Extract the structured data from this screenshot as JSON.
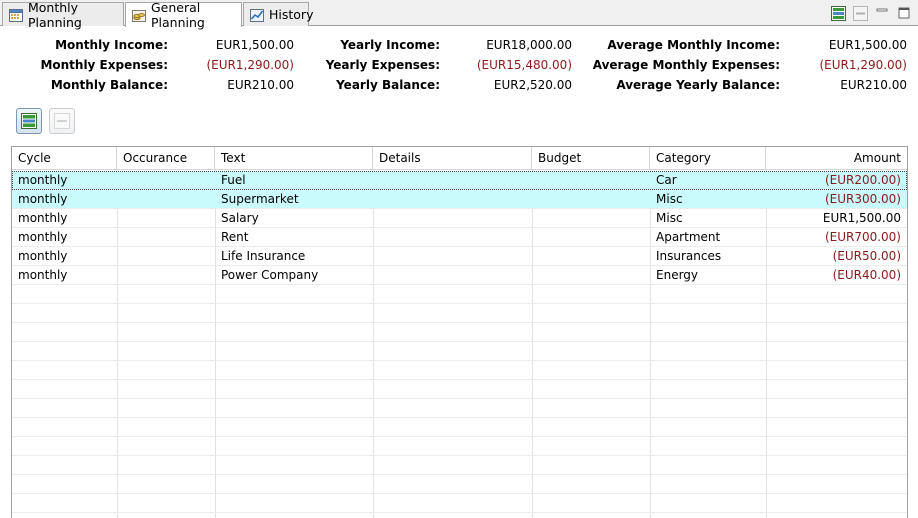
{
  "tabs": [
    {
      "label": "Monthly Planning",
      "icon": "calendar-icon"
    },
    {
      "label": "General Planning",
      "icon": "coins-icon"
    },
    {
      "label": "History",
      "icon": "chart-icon"
    }
  ],
  "summary": {
    "monthly_income_label": "Monthly Income:",
    "monthly_income_value": "EUR1,500.00",
    "monthly_expenses_label": "Monthly Expenses:",
    "monthly_expenses_value": "(EUR1,290.00)",
    "monthly_balance_label": "Monthly Balance:",
    "monthly_balance_value": "EUR210.00",
    "yearly_income_label": "Yearly Income:",
    "yearly_income_value": "EUR18,000.00",
    "yearly_expenses_label": "Yearly Expenses:",
    "yearly_expenses_value": "(EUR15,480.00)",
    "yearly_balance_label": "Yearly Balance:",
    "yearly_balance_value": "EUR2,520.00",
    "avg_monthly_income_label": "Average Monthly Income:",
    "avg_monthly_income_value": "EUR1,500.00",
    "avg_monthly_expenses_label": "Average Monthly Expenses:",
    "avg_monthly_expenses_value": "(EUR1,290.00)",
    "avg_yearly_balance_label": "Average Yearly Balance:",
    "avg_yearly_balance_value": "EUR210.00"
  },
  "colors": {
    "negative": "#8b1a1a",
    "selected_row": "#c9fbfd"
  },
  "table": {
    "columns": [
      "Cycle",
      "Occurance",
      "Text",
      "Details",
      "Budget",
      "Category",
      "Amount"
    ],
    "rows": [
      {
        "cycle": "monthly",
        "occurance": "",
        "text": "Fuel",
        "details": "",
        "budget": "",
        "category": "Car",
        "amount": "(EUR200.00)"
      },
      {
        "cycle": "monthly",
        "occurance": "",
        "text": "Supermarket",
        "details": "",
        "budget": "",
        "category": "Misc",
        "amount": "(EUR300.00)"
      },
      {
        "cycle": "monthly",
        "occurance": "",
        "text": "Salary",
        "details": "",
        "budget": "",
        "category": "Misc",
        "amount": "EUR1,500.00"
      },
      {
        "cycle": "monthly",
        "occurance": "",
        "text": "Rent",
        "details": "",
        "budget": "",
        "category": "Apartment",
        "amount": "(EUR700.00)"
      },
      {
        "cycle": "monthly",
        "occurance": "",
        "text": "Life Insurance",
        "details": "",
        "budget": "",
        "category": "Insurances",
        "amount": "(EUR50.00)"
      },
      {
        "cycle": "monthly",
        "occurance": "",
        "text": "Power Company",
        "details": "",
        "budget": "",
        "category": "Energy",
        "amount": "(EUR40.00)"
      }
    ]
  }
}
